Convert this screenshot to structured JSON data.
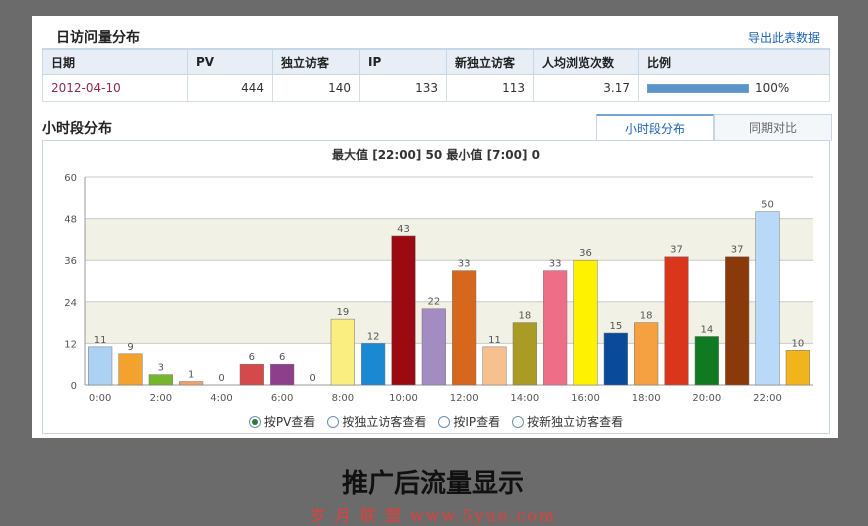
{
  "header": {
    "title": "日访问量分布",
    "export_label": "导出此表数据"
  },
  "table": {
    "columns": [
      "日期",
      "PV",
      "独立访客",
      "IP",
      "新独立访客",
      "人均浏览次数",
      "比例"
    ],
    "row": {
      "date": "2012-04-10",
      "pv": "444",
      "uv": "140",
      "ip": "133",
      "new_uv": "113",
      "avg_views": "3.17",
      "ratio_text": "100%",
      "ratio_value": 1.0
    }
  },
  "hourly": {
    "title": "小时段分布",
    "tabs": [
      {
        "label": "小时段分布",
        "active": true
      },
      {
        "label": "同期对比",
        "active": false
      }
    ],
    "summary": "最大值 [22:00]  50    最小值 [7:00]  0"
  },
  "chart_data": {
    "type": "bar",
    "title": "",
    "xlabel": "",
    "ylabel": "",
    "ylim": [
      0,
      60
    ],
    "yticks": [
      0,
      12,
      24,
      36,
      48,
      60
    ],
    "x_tick_labels": [
      "0:00",
      "2:00",
      "4:00",
      "6:00",
      "8:00",
      "10:00",
      "12:00",
      "14:00",
      "16:00",
      "18:00",
      "20:00",
      "22:00"
    ],
    "categories": [
      "0",
      "1",
      "2",
      "3",
      "4",
      "5",
      "6",
      "7",
      "8",
      "9",
      "10",
      "11",
      "12",
      "13",
      "14",
      "15",
      "16",
      "17",
      "18",
      "19",
      "20",
      "21",
      "22",
      "23"
    ],
    "values": [
      11,
      9,
      3,
      1,
      0,
      6,
      6,
      0,
      19,
      12,
      43,
      22,
      33,
      11,
      18,
      33,
      36,
      15,
      18,
      37,
      14,
      37,
      50,
      10
    ],
    "bar_colors": [
      "#acd1f3",
      "#f3a22e",
      "#76b52e",
      "#f0a06a",
      "#e8a887",
      "#d4494a",
      "#8e3f8c",
      "#d9dce0",
      "#faee80",
      "#1b88d3",
      "#9b0a10",
      "#a28cc2",
      "#d8671e",
      "#f6c08f",
      "#a99b24",
      "#ef6e87",
      "#fff200",
      "#0a4a9a",
      "#f5a142",
      "#d9361c",
      "#107a22",
      "#8a3a0a",
      "#b8d9f7",
      "#f1b41b"
    ],
    "grid": true
  },
  "view_options": [
    {
      "label": "按PV查看",
      "selected": true
    },
    {
      "label": "按独立访客查看",
      "selected": false
    },
    {
      "label": "按IP查看",
      "selected": false
    },
    {
      "label": "按新独立访客查看",
      "selected": false
    }
  ],
  "caption": "推广后流量显示",
  "watermark": "岁 月 联 盟  www.5yue.com"
}
